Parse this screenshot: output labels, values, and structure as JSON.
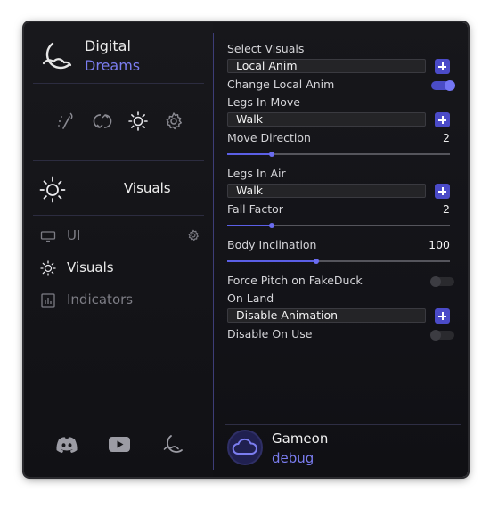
{
  "brand": {
    "name": "Digital",
    "sub": "Dreams",
    "accent": "#7b7df0"
  },
  "top_icons": [
    "wand-icon",
    "undo-redo-icon",
    "sun-icon",
    "gear-icon"
  ],
  "current_section": {
    "label": "Visuals",
    "icon": "sun-icon"
  },
  "nav": [
    {
      "label": "UI",
      "icon": "monitor-icon",
      "active": false
    },
    {
      "label": "Visuals",
      "icon": "sun-icon",
      "active": true
    },
    {
      "label": "Indicators",
      "icon": "bar-chart-icon",
      "active": false
    }
  ],
  "social": [
    "discord-icon",
    "youtube-icon",
    "moon-logo-icon"
  ],
  "settings": {
    "select_visuals": {
      "label": "Select Visuals",
      "value": "Local Anim"
    },
    "change_local_anim": {
      "label": "Change Local Anim",
      "on": true
    },
    "legs_in_move": {
      "label": "Legs In Move",
      "value": "Walk"
    },
    "move_direction": {
      "label": "Move Direction",
      "value": "2",
      "fraction": 0.2
    },
    "legs_in_air": {
      "label": "Legs In Air",
      "value": "Walk"
    },
    "fall_factor": {
      "label": "Fall Factor",
      "value": "2",
      "fraction": 0.2
    },
    "body_inclination": {
      "label": "Body Inclination",
      "value": "100",
      "fraction": 0.4
    },
    "force_pitch": {
      "label": "Force Pitch on FakeDuck",
      "on": false
    },
    "on_land": {
      "label": "On Land",
      "value": "Disable Animation"
    },
    "disable_on_use": {
      "label": "Disable On Use",
      "on": false
    }
  },
  "user": {
    "name": "Gameon",
    "role": "debug"
  }
}
